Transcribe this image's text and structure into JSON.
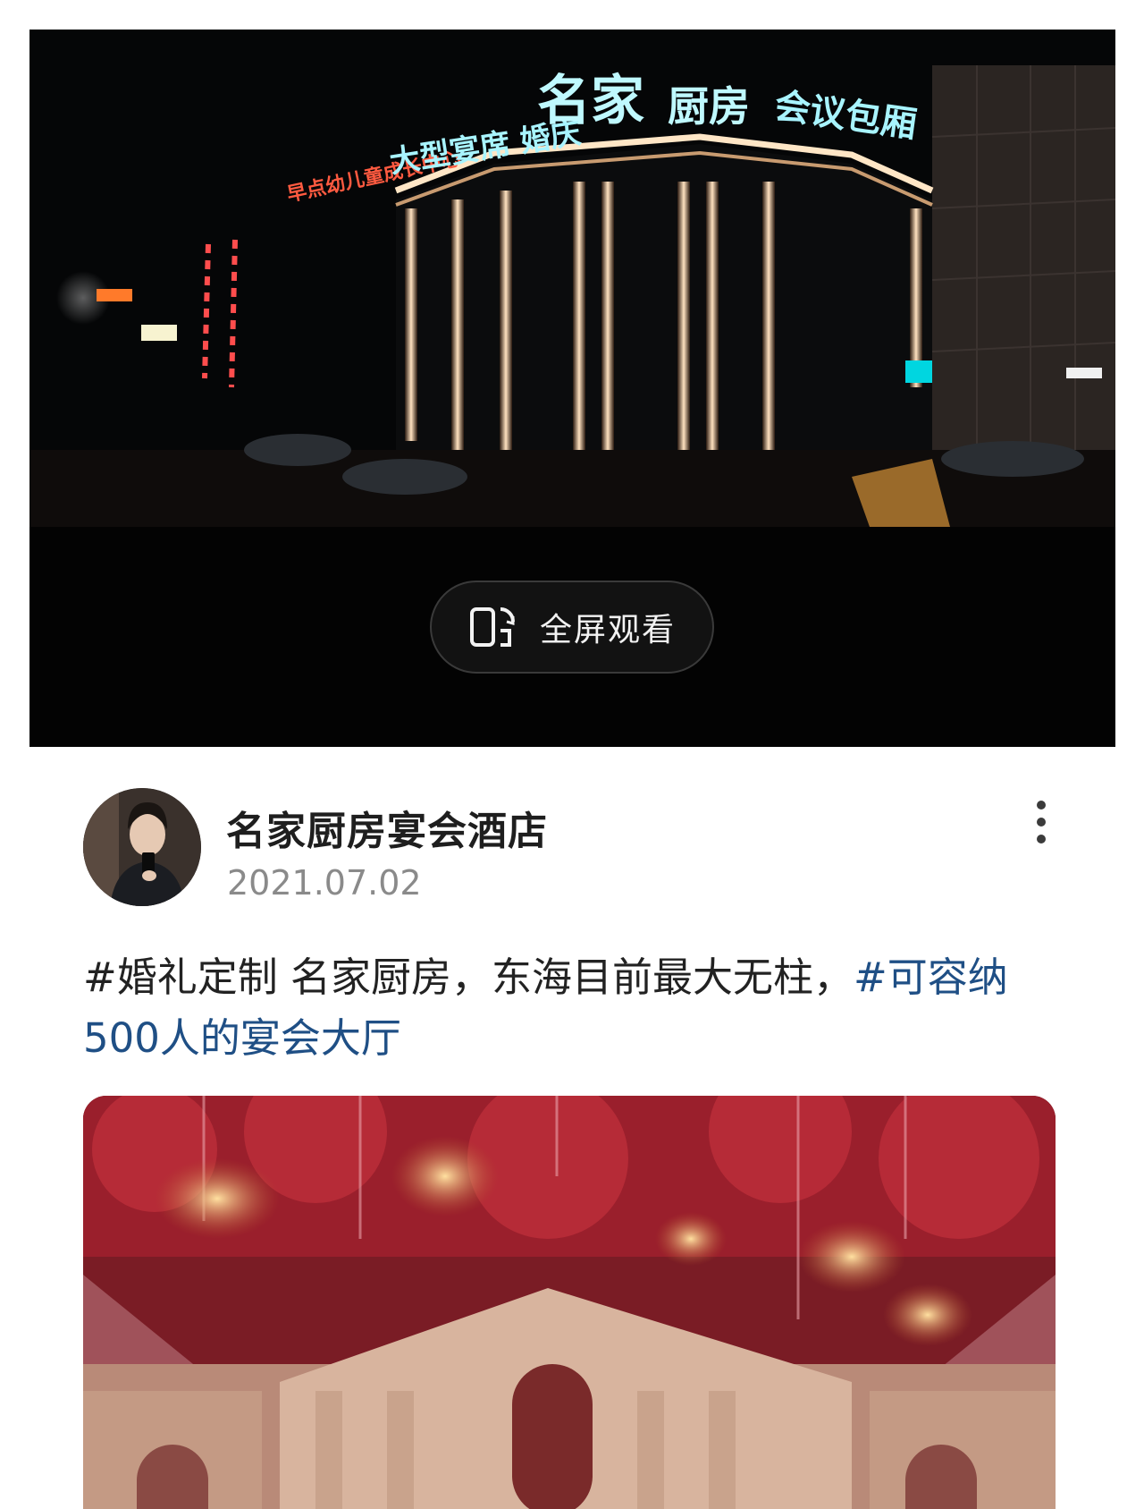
{
  "video": {
    "fullscreen_label": "全屏观看",
    "sign_main": "名家",
    "sign_kitchen": "厨房",
    "sign_left": "大型宴席 婚庆",
    "sign_right": "会议包厢",
    "sign_far_left": "早点幼儿童成长中心"
  },
  "post": {
    "author": "名家厨房宴会酒店",
    "date": "2021.07.02",
    "text_plain": "#婚礼定制 名家厨房，东海目前最大无柱，",
    "text_link": "#可容纳500人的宴会大厅"
  },
  "colors": {
    "hashtag": "#1f4f85",
    "video_bg": "#030303",
    "sign_cyan": "#a8f4ff"
  },
  "icons": {
    "fullscreen": "rotate-screen-icon",
    "more": "more-vertical-icon"
  }
}
